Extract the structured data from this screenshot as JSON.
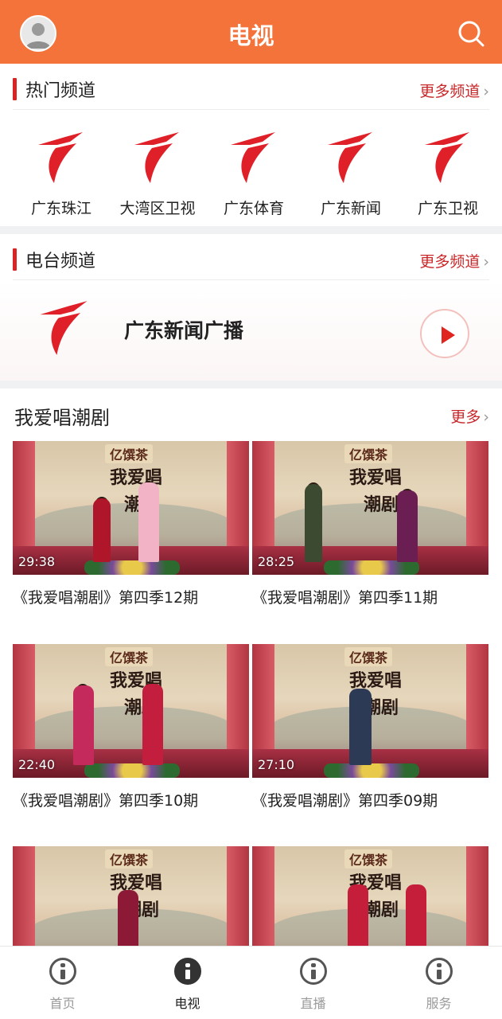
{
  "header": {
    "title": "电视",
    "icons": {
      "avatar": "user-avatar-icon",
      "search": "search-icon"
    }
  },
  "hot_channels": {
    "title": "热门频道",
    "more": "更多频道",
    "items": [
      {
        "name": "广东珠江"
      },
      {
        "name": "大湾区卫视"
      },
      {
        "name": "广东体育"
      },
      {
        "name": "广东新闻"
      },
      {
        "name": "广东卫视"
      }
    ]
  },
  "radio": {
    "title": "电台频道",
    "more": "更多频道",
    "station": "广东新闻广播"
  },
  "opera": {
    "title": "我爱唱潮剧",
    "more": "更多",
    "thumb_brand": "亿馔茶",
    "thumb_text_1": "我爱唱",
    "thumb_text_2": "潮剧",
    "videos": [
      {
        "duration": "29:38",
        "title": "《我爱唱潮剧》第四季12期"
      },
      {
        "duration": "28:25",
        "title": "《我爱唱潮剧》第四季11期"
      },
      {
        "duration": "22:40",
        "title": "《我爱唱潮剧》第四季10期"
      },
      {
        "duration": "27:10",
        "title": "《我爱唱潮剧》第四季09期"
      },
      {
        "duration": "",
        "title": ""
      },
      {
        "duration": "",
        "title": ""
      }
    ]
  },
  "bottom_nav": {
    "items": [
      {
        "label": "首页",
        "icon": "info-icon"
      },
      {
        "label": "电视",
        "icon": "info-icon"
      },
      {
        "label": "直播",
        "icon": "info-icon"
      },
      {
        "label": "服务",
        "icon": "info-icon"
      }
    ],
    "active": "电视"
  },
  "colors": {
    "accent": "#f4733a",
    "brand_red": "#d82424",
    "more_link": "#c8282a"
  }
}
